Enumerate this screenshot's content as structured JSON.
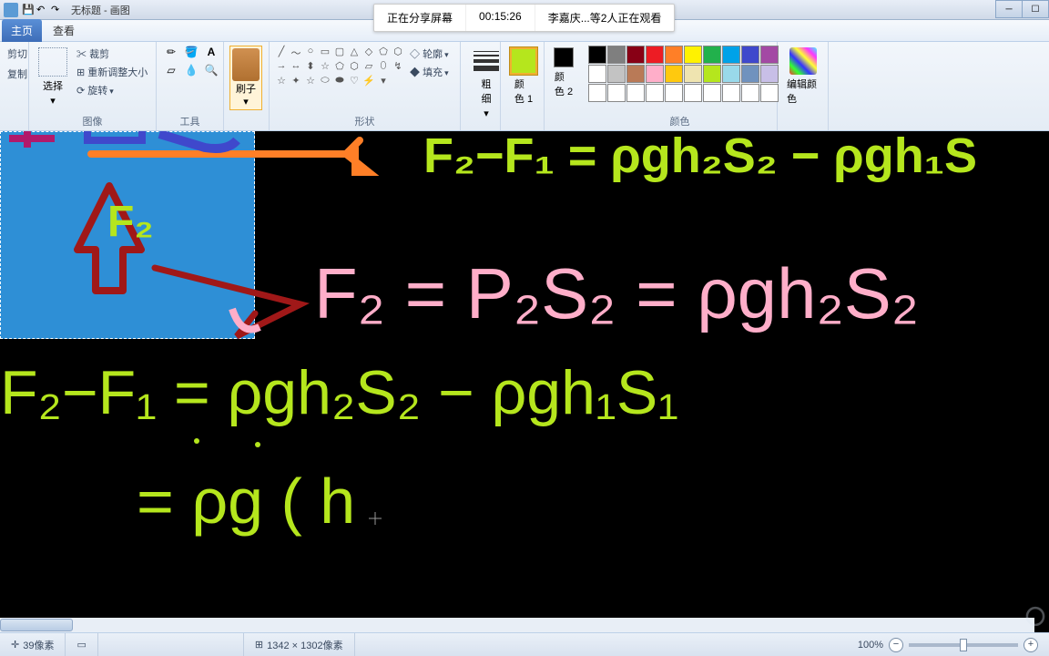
{
  "window": {
    "title": "无标题 - 画图"
  },
  "share_overlay": {
    "sharing": "正在分享屏幕",
    "timer": "00:15:26",
    "viewers": "李嘉庆...等2人正在观看"
  },
  "tabs": {
    "home": "主页",
    "view": "查看"
  },
  "ribbon": {
    "clipboard": {
      "cut": "剪切",
      "copy": "复制",
      "label": ""
    },
    "image": {
      "select": "选择",
      "crop": "裁剪",
      "resize": "重新调整大小",
      "rotate": "旋转",
      "label": "图像"
    },
    "tools": {
      "label": "工具"
    },
    "brush": {
      "label": "刷子"
    },
    "shapes": {
      "outline": "轮廓",
      "fill": "填充",
      "label": "形状"
    },
    "size": {
      "label": "粗\n细"
    },
    "color1": {
      "label": "颜\n色 1"
    },
    "color2": {
      "label": "颜\n色 2"
    },
    "colors": {
      "label": "颜色"
    },
    "edit_colors": {
      "label": "编辑颜色"
    }
  },
  "palette_main": [
    "#000000",
    "#7f7f7f",
    "#880015",
    "#ed1c24",
    "#ff7f27",
    "#fff200",
    "#22b14c",
    "#00a2e8",
    "#3f48cc",
    "#a349a4",
    "#ffffff",
    "#c3c3c3",
    "#b97a57",
    "#ffaec9",
    "#ffc90e",
    "#efe4b0",
    "#b5e61d",
    "#99d9ea",
    "#7092be",
    "#c8bfe7"
  ],
  "palette_empty_count": 10,
  "selected_color": "#b5e61d",
  "color2_value": "#000000",
  "statusbar": {
    "coords": "39像素",
    "dims": "1342 × 1302像素",
    "zoom": "100%"
  }
}
